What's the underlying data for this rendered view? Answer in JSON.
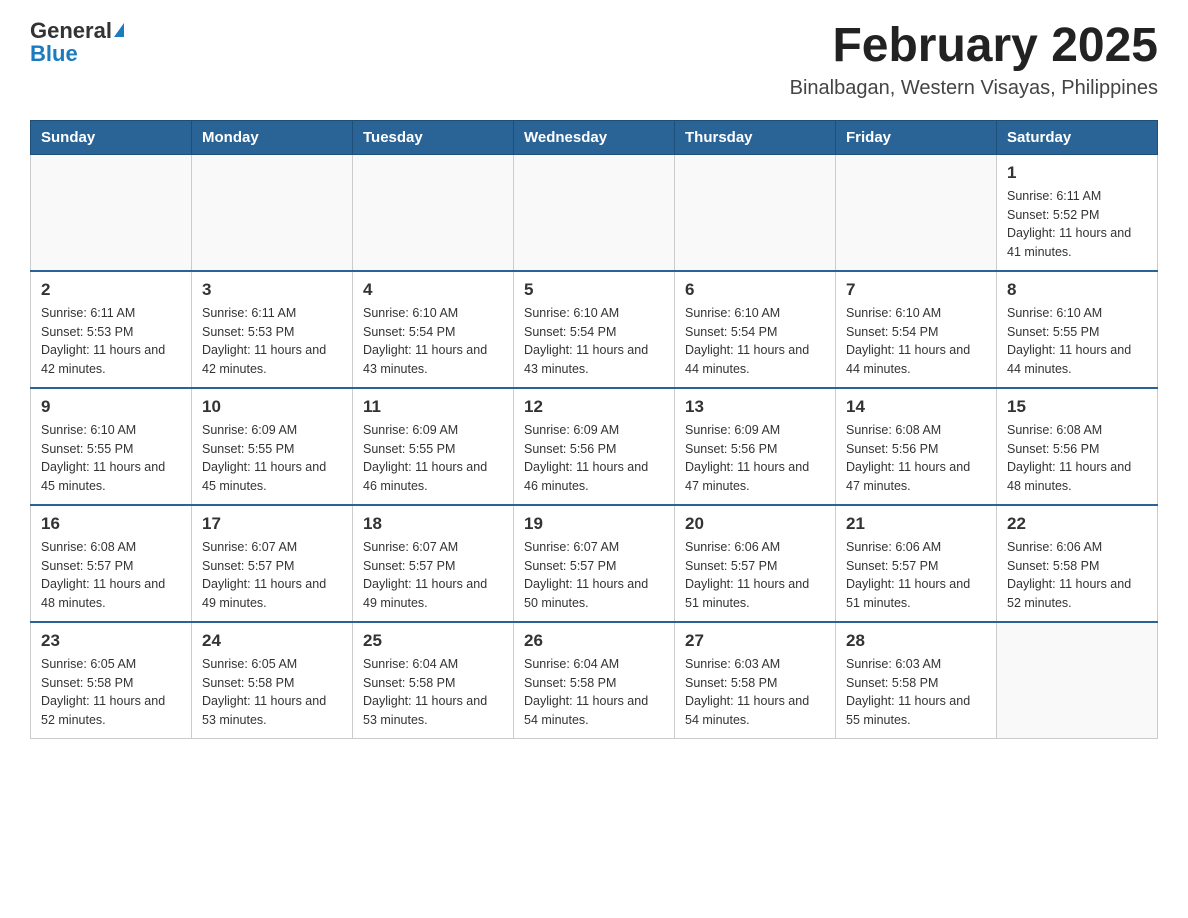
{
  "header": {
    "logo_general": "General",
    "logo_blue": "Blue",
    "month_year": "February 2025",
    "location": "Binalbagan, Western Visayas, Philippines"
  },
  "days_of_week": [
    "Sunday",
    "Monday",
    "Tuesday",
    "Wednesday",
    "Thursday",
    "Friday",
    "Saturday"
  ],
  "weeks": [
    [
      {
        "day": "",
        "sunrise": "",
        "sunset": "",
        "daylight": ""
      },
      {
        "day": "",
        "sunrise": "",
        "sunset": "",
        "daylight": ""
      },
      {
        "day": "",
        "sunrise": "",
        "sunset": "",
        "daylight": ""
      },
      {
        "day": "",
        "sunrise": "",
        "sunset": "",
        "daylight": ""
      },
      {
        "day": "",
        "sunrise": "",
        "sunset": "",
        "daylight": ""
      },
      {
        "day": "",
        "sunrise": "",
        "sunset": "",
        "daylight": ""
      },
      {
        "day": "1",
        "sunrise": "Sunrise: 6:11 AM",
        "sunset": "Sunset: 5:52 PM",
        "daylight": "Daylight: 11 hours and 41 minutes."
      }
    ],
    [
      {
        "day": "2",
        "sunrise": "Sunrise: 6:11 AM",
        "sunset": "Sunset: 5:53 PM",
        "daylight": "Daylight: 11 hours and 42 minutes."
      },
      {
        "day": "3",
        "sunrise": "Sunrise: 6:11 AM",
        "sunset": "Sunset: 5:53 PM",
        "daylight": "Daylight: 11 hours and 42 minutes."
      },
      {
        "day": "4",
        "sunrise": "Sunrise: 6:10 AM",
        "sunset": "Sunset: 5:54 PM",
        "daylight": "Daylight: 11 hours and 43 minutes."
      },
      {
        "day": "5",
        "sunrise": "Sunrise: 6:10 AM",
        "sunset": "Sunset: 5:54 PM",
        "daylight": "Daylight: 11 hours and 43 minutes."
      },
      {
        "day": "6",
        "sunrise": "Sunrise: 6:10 AM",
        "sunset": "Sunset: 5:54 PM",
        "daylight": "Daylight: 11 hours and 44 minutes."
      },
      {
        "day": "7",
        "sunrise": "Sunrise: 6:10 AM",
        "sunset": "Sunset: 5:54 PM",
        "daylight": "Daylight: 11 hours and 44 minutes."
      },
      {
        "day": "8",
        "sunrise": "Sunrise: 6:10 AM",
        "sunset": "Sunset: 5:55 PM",
        "daylight": "Daylight: 11 hours and 44 minutes."
      }
    ],
    [
      {
        "day": "9",
        "sunrise": "Sunrise: 6:10 AM",
        "sunset": "Sunset: 5:55 PM",
        "daylight": "Daylight: 11 hours and 45 minutes."
      },
      {
        "day": "10",
        "sunrise": "Sunrise: 6:09 AM",
        "sunset": "Sunset: 5:55 PM",
        "daylight": "Daylight: 11 hours and 45 minutes."
      },
      {
        "day": "11",
        "sunrise": "Sunrise: 6:09 AM",
        "sunset": "Sunset: 5:55 PM",
        "daylight": "Daylight: 11 hours and 46 minutes."
      },
      {
        "day": "12",
        "sunrise": "Sunrise: 6:09 AM",
        "sunset": "Sunset: 5:56 PM",
        "daylight": "Daylight: 11 hours and 46 minutes."
      },
      {
        "day": "13",
        "sunrise": "Sunrise: 6:09 AM",
        "sunset": "Sunset: 5:56 PM",
        "daylight": "Daylight: 11 hours and 47 minutes."
      },
      {
        "day": "14",
        "sunrise": "Sunrise: 6:08 AM",
        "sunset": "Sunset: 5:56 PM",
        "daylight": "Daylight: 11 hours and 47 minutes."
      },
      {
        "day": "15",
        "sunrise": "Sunrise: 6:08 AM",
        "sunset": "Sunset: 5:56 PM",
        "daylight": "Daylight: 11 hours and 48 minutes."
      }
    ],
    [
      {
        "day": "16",
        "sunrise": "Sunrise: 6:08 AM",
        "sunset": "Sunset: 5:57 PM",
        "daylight": "Daylight: 11 hours and 48 minutes."
      },
      {
        "day": "17",
        "sunrise": "Sunrise: 6:07 AM",
        "sunset": "Sunset: 5:57 PM",
        "daylight": "Daylight: 11 hours and 49 minutes."
      },
      {
        "day": "18",
        "sunrise": "Sunrise: 6:07 AM",
        "sunset": "Sunset: 5:57 PM",
        "daylight": "Daylight: 11 hours and 49 minutes."
      },
      {
        "day": "19",
        "sunrise": "Sunrise: 6:07 AM",
        "sunset": "Sunset: 5:57 PM",
        "daylight": "Daylight: 11 hours and 50 minutes."
      },
      {
        "day": "20",
        "sunrise": "Sunrise: 6:06 AM",
        "sunset": "Sunset: 5:57 PM",
        "daylight": "Daylight: 11 hours and 51 minutes."
      },
      {
        "day": "21",
        "sunrise": "Sunrise: 6:06 AM",
        "sunset": "Sunset: 5:57 PM",
        "daylight": "Daylight: 11 hours and 51 minutes."
      },
      {
        "day": "22",
        "sunrise": "Sunrise: 6:06 AM",
        "sunset": "Sunset: 5:58 PM",
        "daylight": "Daylight: 11 hours and 52 minutes."
      }
    ],
    [
      {
        "day": "23",
        "sunrise": "Sunrise: 6:05 AM",
        "sunset": "Sunset: 5:58 PM",
        "daylight": "Daylight: 11 hours and 52 minutes."
      },
      {
        "day": "24",
        "sunrise": "Sunrise: 6:05 AM",
        "sunset": "Sunset: 5:58 PM",
        "daylight": "Daylight: 11 hours and 53 minutes."
      },
      {
        "day": "25",
        "sunrise": "Sunrise: 6:04 AM",
        "sunset": "Sunset: 5:58 PM",
        "daylight": "Daylight: 11 hours and 53 minutes."
      },
      {
        "day": "26",
        "sunrise": "Sunrise: 6:04 AM",
        "sunset": "Sunset: 5:58 PM",
        "daylight": "Daylight: 11 hours and 54 minutes."
      },
      {
        "day": "27",
        "sunrise": "Sunrise: 6:03 AM",
        "sunset": "Sunset: 5:58 PM",
        "daylight": "Daylight: 11 hours and 54 minutes."
      },
      {
        "day": "28",
        "sunrise": "Sunrise: 6:03 AM",
        "sunset": "Sunset: 5:58 PM",
        "daylight": "Daylight: 11 hours and 55 minutes."
      },
      {
        "day": "",
        "sunrise": "",
        "sunset": "",
        "daylight": ""
      }
    ]
  ]
}
